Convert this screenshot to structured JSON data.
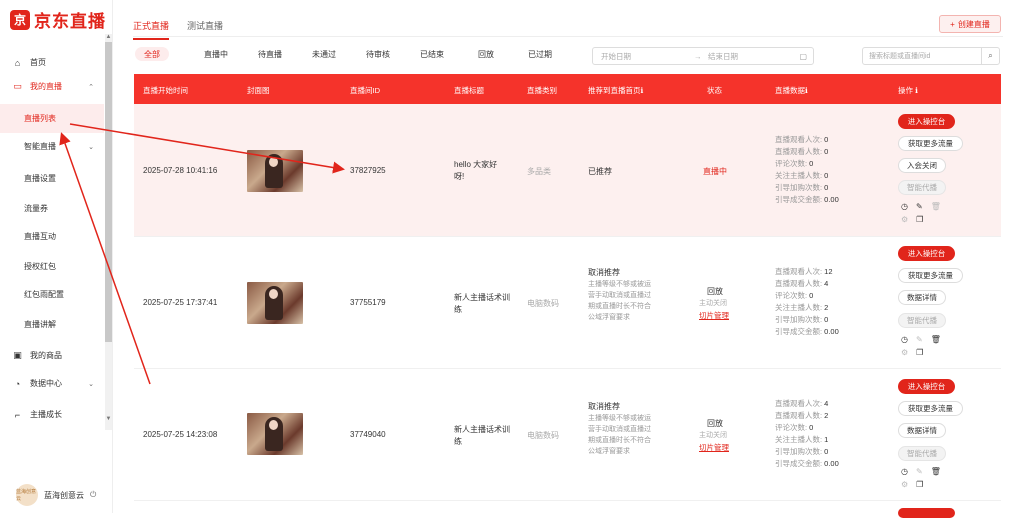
{
  "app": {
    "logo_mark": "京",
    "logo_text": "京东直播",
    "brand_color": "#e1251b"
  },
  "sidebar": {
    "items": [
      {
        "label": "首页",
        "icon": "home-icon",
        "glyph": "⌂"
      },
      {
        "label": "我的直播",
        "icon": "live-icon",
        "glyph": "▭",
        "chevron": "⌃"
      },
      {
        "label": "直播列表"
      },
      {
        "label": "智能直播",
        "chevron": "⌄"
      },
      {
        "label": "直播设置"
      },
      {
        "label": "流量券"
      },
      {
        "label": "直播互动"
      },
      {
        "label": "授权红包"
      },
      {
        "label": "红包雨配置"
      },
      {
        "label": "直播讲解"
      },
      {
        "label": "我的商品",
        "icon": "goods-icon",
        "glyph": "▣"
      },
      {
        "label": "数据中心",
        "icon": "data-icon",
        "glyph": "◔",
        "chevron": "⌄"
      },
      {
        "label": "主播成长",
        "icon": "growth-icon",
        "glyph": "⌐"
      }
    ],
    "user": {
      "avatar_text": "蓝海创意云",
      "name": "蓝海创意云",
      "logout_glyph": "⏻"
    }
  },
  "header": {
    "tabs": [
      "正式直播",
      "测试直播"
    ],
    "create_button": "创建直播",
    "create_icon": "+"
  },
  "filters": [
    "全部",
    "直播中",
    "待直播",
    "未通过",
    "待审核",
    "已结束",
    "回放",
    "已过期"
  ],
  "date_range": {
    "start_placeholder": "开始日期",
    "arrow": "→",
    "end_placeholder": "结束日期",
    "cal_glyph": "▢"
  },
  "search": {
    "placeholder": "搜索标题或直播间id",
    "glyph": "⌕"
  },
  "table": {
    "headers": [
      "直播开始时间",
      "封面图",
      "直播间ID",
      "直播标题",
      "直播类别",
      "推荐到直播首页",
      "状态",
      "直播数据",
      "操作"
    ],
    "info_glyph": "ℹ",
    "stat_labels": [
      "直播观看人次: ",
      "直播观看人数: ",
      "评论次数: ",
      "关注主播人数: ",
      "引导加购次数: ",
      "引导成交金额: "
    ],
    "rows": [
      {
        "time": "2025-07-28 10:41:16",
        "room_id": "37827925",
        "title": "hello 大家好呀!",
        "category": "多品类",
        "recommend": "已推荐",
        "recommend_desc": "",
        "status": "直播中",
        "status_sub": "",
        "status_link": "",
        "stats": [
          "0",
          "0",
          "0",
          "0",
          "0",
          "0.00"
        ],
        "buttons": [
          "进入操控台",
          "获取更多流量",
          "入会关闭",
          "智能代播"
        ]
      },
      {
        "time": "2025-07-25 17:37:41",
        "room_id": "37755179",
        "title": "新人主播话术训练",
        "category": "电脑数码",
        "recommend": "取消推荐",
        "recommend_desc": "主播等级不够或被运营手动取消或直播过期或直播时长不符合公域浮窗要求",
        "status": "回放",
        "status_sub": "主动关闭",
        "status_link": "切片管理",
        "stats": [
          "12",
          "4",
          "0",
          "2",
          "0",
          "0.00"
        ],
        "buttons": [
          "进入操控台",
          "获取更多流量",
          "数据详情",
          "智能代播"
        ]
      },
      {
        "time": "2025-07-25 14:23:08",
        "room_id": "37749040",
        "title": "新人主播话术训练",
        "category": "电脑数码",
        "recommend": "取消推荐",
        "recommend_desc": "主播等级不够或被运营手动取消或直播过期或直播时长不符合公域浮窗要求",
        "status": "回放",
        "status_sub": "主动关闭",
        "status_link": "切片管理",
        "stats": [
          "4",
          "2",
          "0",
          "1",
          "0",
          "0.00"
        ],
        "buttons": [
          "进入操控台",
          "获取更多流量",
          "数据详情",
          "智能代播"
        ]
      }
    ],
    "action_icons": {
      "clock": "◷",
      "edit": "✎",
      "trash": "🗑",
      "settings": "⚙",
      "copy": "❐"
    }
  },
  "annotation_color": "#e1251b"
}
